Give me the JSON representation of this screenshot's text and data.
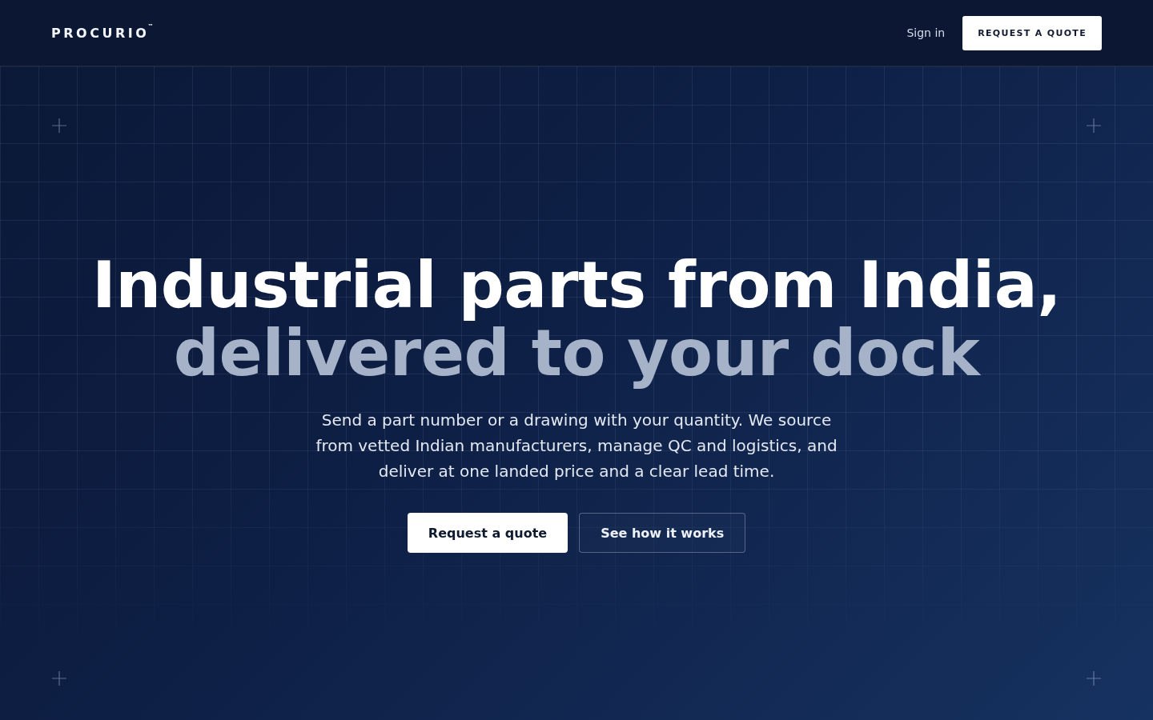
{
  "header": {
    "logo": "PROCURIO$^{™}$",
    "links": [
      {
        "label": "Sign in"
      }
    ],
    "cta": {
      "label": "REQUEST A QUOTE"
    }
  },
  "hero": {
    "headline": "Industrial parts from India,",
    "headline_accent": "delivered to your dock",
    "description": "Send a part number or a drawing with your quantity. We source from vetted Indian manufacturers, manage QC and logistics, and deliver at one landed price and a clear lead time.",
    "buttons": [
      {
        "label": "Request a quote",
        "kind": "primary"
      },
      {
        "label": "See how it works",
        "kind": "secondary"
      }
    ]
  }
}
